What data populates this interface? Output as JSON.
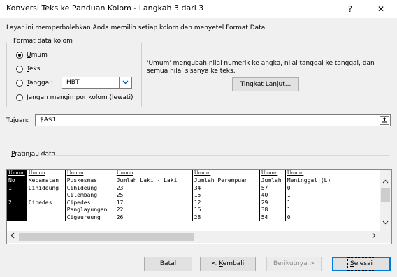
{
  "window": {
    "title": "Konversi Teks ke Panduan Kolom - Langkah 3 dari 3",
    "help_label": "?",
    "close_label": "✕"
  },
  "description": "Layar ini memperbolehkan Anda memilih setiap kolom dan menyetel Format Data.",
  "format_group": {
    "label": "Format data kolom",
    "options": [
      {
        "mnemonic": "U",
        "rest": "mum",
        "selected": true
      },
      {
        "mnemonic": "T",
        "rest": "eks",
        "selected": false
      },
      {
        "mnemonic": "T",
        "rest": "anggal:",
        "selected": false
      },
      {
        "before": "Jangan mengimpor kolom (le",
        "mnemonic": "w",
        "after": "ati)",
        "selected": false
      }
    ],
    "date_format": {
      "value": "HBT",
      "icon": "chevron-down-icon"
    }
  },
  "info_text": "'Umum' mengubah nilai numerik ke angka, nilai tanggal ke tanggal, dan semua nilai sisanya ke teks.",
  "advanced_button": {
    "before": "Ting",
    "mnemonic": "k",
    "after": "at Lanjut..."
  },
  "destination": {
    "label": "Tujuan:",
    "value": "$A$1",
    "icon": "collapse-dialog-icon"
  },
  "preview": {
    "label_mnemonic": "P",
    "label_rest": "ratinjau data",
    "headers": [
      "Umum",
      "Umum",
      "Umum",
      "Umum",
      "Umum",
      "Umum",
      "Umum"
    ],
    "rows": [
      [
        "No",
        "Kecamatan",
        "Puskesmas",
        "Jumlah Laki - Laki",
        "Jumlah Perempuan",
        "Jumlah",
        "Meninggal (L)"
      ],
      [
        "1",
        "Cihideung",
        "Cihideung",
        "23",
        "34",
        "57",
        "0"
      ],
      [
        "",
        "",
        "Cilembang",
        "25",
        "15",
        "40",
        "1"
      ],
      [
        "2",
        "Cipedes",
        "Cipedes",
        "17",
        "12",
        "29",
        "1"
      ],
      [
        "",
        "",
        "Panglayungan",
        "22",
        "16",
        "38",
        "1"
      ],
      [
        "",
        "",
        "Cigeureung",
        "26",
        "28",
        "54",
        "0"
      ]
    ]
  },
  "footer": {
    "cancel": "Batal",
    "back": {
      "before": "< ",
      "mnemonic": "K",
      "after": "embali"
    },
    "next": "Berikutnya >",
    "finish": {
      "mnemonic": "S",
      "after": "elesai"
    }
  }
}
